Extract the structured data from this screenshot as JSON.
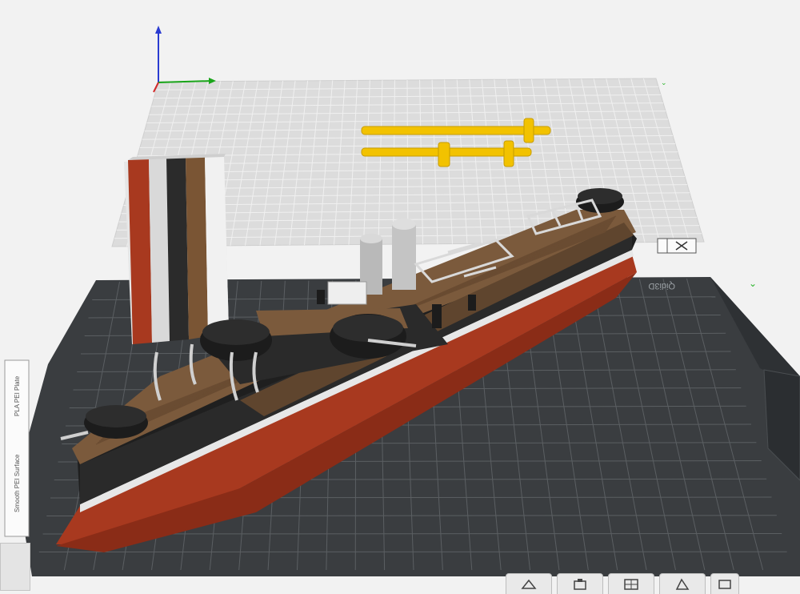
{
  "viewport": {
    "background_color": "#f2f2f2",
    "grid_plane_color": "#d9d9d9",
    "build_plate_color": "#3a3d40",
    "axis_colors": {
      "x": "#1aa51a",
      "y": "#d12a2a",
      "z": "#2a3bd1"
    }
  },
  "build_plate": {
    "brand_text": "Qidi3D",
    "side_label_top": "PLA PEI Plate",
    "side_label_bottom": "Smooth PEI Surface",
    "grid_line_color": "#5b5f62"
  },
  "models": {
    "ship_name": "",
    "purge_tower_colors": [
      "#a8391f",
      "#d9d9d9",
      "#2b2b2b",
      "#7a5534",
      "#ececec"
    ],
    "parts_color": "#f2c200"
  },
  "toolbar": {
    "buttons": [
      {
        "name": "slice-plate-button",
        "icon": "plate-icon"
      },
      {
        "name": "auto-orient-button",
        "icon": "orient-icon"
      },
      {
        "name": "arrange-button",
        "icon": "arrange-icon"
      },
      {
        "name": "split-button",
        "icon": "split-icon"
      },
      {
        "name": "more-button",
        "icon": "more-icon"
      }
    ]
  },
  "icons": {
    "plate_lock": "lock-icon",
    "plate_close": "close-icon",
    "plate_settings": "settings-icon",
    "plate_camera": "camera-icon"
  }
}
